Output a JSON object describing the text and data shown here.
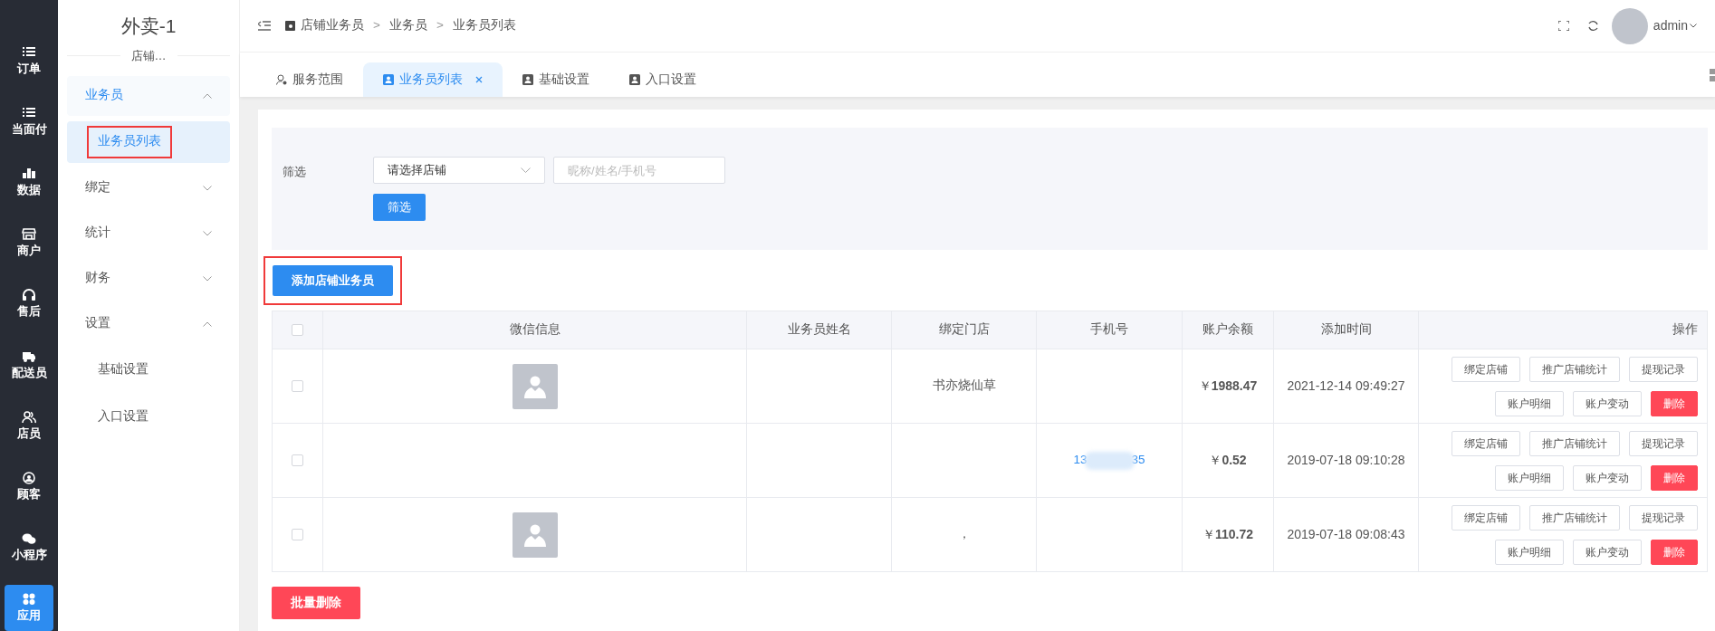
{
  "rail": [
    {
      "label": "订单",
      "selected": false
    },
    {
      "label": "当面付",
      "selected": false
    },
    {
      "label": "数据",
      "selected": false
    },
    {
      "label": "商户",
      "selected": false
    },
    {
      "label": "售后",
      "selected": false
    },
    {
      "label": "配送员",
      "selected": false
    },
    {
      "label": "店员",
      "selected": false
    },
    {
      "label": "顾客",
      "selected": false
    },
    {
      "label": "小程序",
      "selected": false
    },
    {
      "label": "应用",
      "selected": true
    }
  ],
  "sidebar": {
    "title": "外卖-1",
    "subtitle": "店铺…",
    "items": [
      {
        "label": "业务员",
        "expanded": true,
        "children": [
          {
            "label": "业务员列表",
            "selected": true,
            "highlighted": true
          }
        ]
      },
      {
        "label": "绑定",
        "expanded": false
      },
      {
        "label": "统计",
        "expanded": false
      },
      {
        "label": "财务",
        "expanded": false
      },
      {
        "label": "设置",
        "expanded": true,
        "children": [
          {
            "label": "基础设置",
            "selected": false,
            "highlighted": false
          },
          {
            "label": "入口设置",
            "selected": false,
            "highlighted": false
          }
        ]
      }
    ]
  },
  "breadcrumb": {
    "separator": ">",
    "items": [
      "店铺业务员",
      "业务员",
      "业务员列表"
    ]
  },
  "user": {
    "name": "admin"
  },
  "tabs": [
    {
      "label": "服务范围",
      "selected": false,
      "closable": false
    },
    {
      "label": "业务员列表",
      "selected": true,
      "closable": true
    },
    {
      "label": "基础设置",
      "selected": false,
      "closable": false
    },
    {
      "label": "入口设置",
      "selected": false,
      "closable": false
    }
  ],
  "filter": {
    "label": "筛选",
    "store_select": "请选择店铺",
    "search_placeholder": "昵称/姓名/手机号",
    "button": "筛选"
  },
  "add_button": {
    "label": "添加店铺业务员",
    "highlighted": true
  },
  "table": {
    "columns": [
      "微信信息",
      "业务员姓名",
      "绑定门店",
      "手机号",
      "账户余额",
      "添加时间",
      "操作"
    ],
    "header_checked": false,
    "rows": [
      {
        "checked": false,
        "avatar": true,
        "store": "书亦烧仙草",
        "phone": null,
        "balance": "￥**1988.47**",
        "time": "2021-12-14 09:49:27",
        "actions": [
          {
            "label": "绑定店铺",
            "kind": "default"
          },
          {
            "label": "推广店铺统计",
            "kind": "default"
          },
          {
            "label": "提现记录",
            "kind": "default"
          },
          {
            "label": "账户明细",
            "kind": "default"
          },
          {
            "label": "账户变动",
            "kind": "default"
          },
          {
            "label": "删除",
            "kind": "danger"
          }
        ]
      },
      {
        "checked": false,
        "avatar": false,
        "store": null,
        "phone": {
          "start": "13",
          "end": "35"
        },
        "balance": "￥**0.52**",
        "time": "2019-07-18 09:10:28",
        "actions": [
          {
            "label": "绑定店铺",
            "kind": "default"
          },
          {
            "label": "推广店铺统计",
            "kind": "default"
          },
          {
            "label": "提现记录",
            "kind": "default"
          },
          {
            "label": "账户明细",
            "kind": "default"
          },
          {
            "label": "账户变动",
            "kind": "default"
          },
          {
            "label": "删除",
            "kind": "danger"
          }
        ]
      },
      {
        "checked": false,
        "avatar": true,
        "store": "，",
        "phone": null,
        "balance": "￥**110.72**",
        "time": "2019-07-18 09:08:43",
        "actions": [
          {
            "label": "绑定店铺",
            "kind": "default"
          },
          {
            "label": "推广店铺统计",
            "kind": "default"
          },
          {
            "label": "提现记录",
            "kind": "default"
          },
          {
            "label": "账户明细",
            "kind": "default"
          },
          {
            "label": "账户变动",
            "kind": "default"
          },
          {
            "label": "删除",
            "kind": "danger"
          }
        ]
      }
    ]
  },
  "bulk_delete": "批量删除"
}
